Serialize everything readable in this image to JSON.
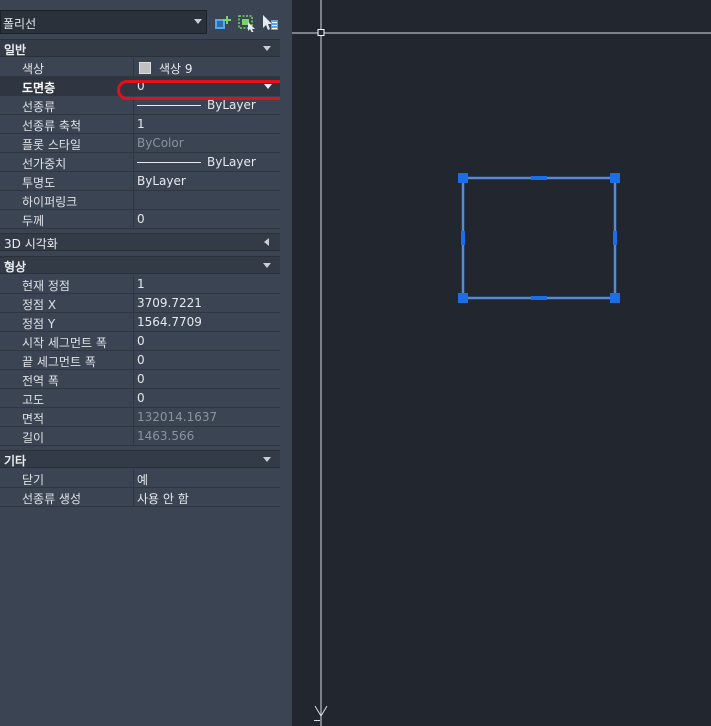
{
  "object_selector": {
    "value": "폴리선"
  },
  "toolbar": [
    {
      "name": "quick-select-icon"
    },
    {
      "name": "select-objects-icon"
    },
    {
      "name": "toggle-pickadd-icon"
    }
  ],
  "sections": {
    "general": {
      "title": "일반",
      "rows": [
        {
          "label": "색상",
          "value": "색상 9",
          "kind": "color",
          "color": "#c0c0c0"
        },
        {
          "label": "도면층",
          "value": "0",
          "kind": "dropdown",
          "selected": true
        },
        {
          "label": "선종류",
          "value": "ByLayer",
          "kind": "linetype"
        },
        {
          "label": "선종류 축척",
          "value": "1"
        },
        {
          "label": "플롯 스타일",
          "value": "ByColor",
          "dim": true
        },
        {
          "label": "선가중치",
          "value": "ByLayer",
          "kind": "linetype"
        },
        {
          "label": "투명도",
          "value": "ByLayer"
        },
        {
          "label": "하이퍼링크",
          "value": ""
        },
        {
          "label": "두께",
          "value": "0"
        }
      ]
    },
    "viz3d": {
      "title": "3D 시각화",
      "collapsed": true
    },
    "geometry": {
      "title": "형상",
      "rows": [
        {
          "label": "현재 정점",
          "value": "1"
        },
        {
          "label": "정점 X",
          "value": "3709.7221"
        },
        {
          "label": "정점 Y",
          "value": "1564.7709"
        },
        {
          "label": "시작 세그먼트 폭",
          "value": "0"
        },
        {
          "label": "끝 세그먼트 폭",
          "value": "0"
        },
        {
          "label": "전역 폭",
          "value": "0"
        },
        {
          "label": "고도",
          "value": "0"
        },
        {
          "label": "면적",
          "value": "132014.1637",
          "dim": true
        },
        {
          "label": "길이",
          "value": "1463.566",
          "dim": true
        }
      ]
    },
    "misc": {
      "title": "기타",
      "rows": [
        {
          "label": "닫기",
          "value": "예"
        },
        {
          "label": "선종류 생성",
          "value": "사용 안 함"
        }
      ]
    }
  },
  "colors": {
    "selection_blue": "#1a6fe8",
    "annotation_red": "#e50f1b"
  }
}
